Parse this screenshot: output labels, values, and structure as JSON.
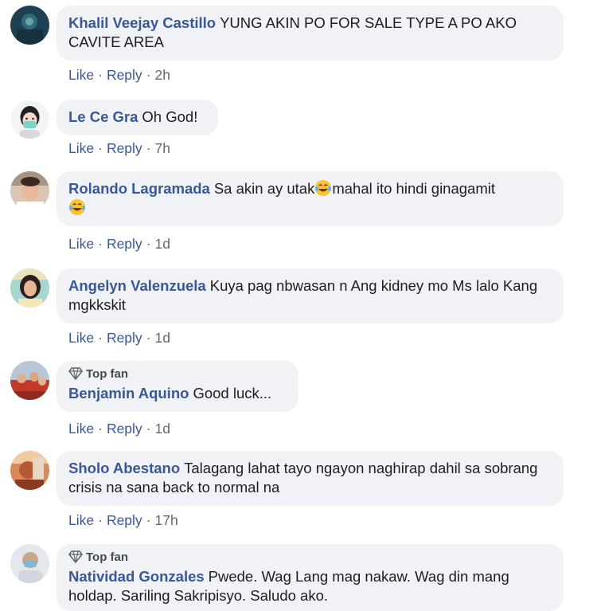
{
  "comments": [
    {
      "author": "Khalil Veejay Castillo",
      "text": "YUNG AKIN PO FOR SALE TYPE A PO AKO CAVITE AREA",
      "time": "2h",
      "top_fan": false,
      "avatar_icon": "profile-photo-dark-blue"
    },
    {
      "author": "Le Ce Gra",
      "text": "Oh God!",
      "time": "7h",
      "top_fan": false,
      "avatar_icon": "profile-cartoon-girl-mask"
    },
    {
      "author": "Rolando Lagramada",
      "text_before_emoji": "Sa akin ay utak",
      "text_after_emoji": "mahal ito hindi ginagamit",
      "emoji_icon": "laughing-tears-emoji",
      "time": "1d",
      "top_fan": false,
      "avatar_icon": "profile-photo-man"
    },
    {
      "author": "Angelyn Valenzuela",
      "text": "Kuya pag nbwasan n Ang kidney mo Ms lalo Kang mgkkskit",
      "time": "1d",
      "top_fan": false,
      "avatar_icon": "profile-photo-woman"
    },
    {
      "author": "Benjamin Aquino",
      "text": "Good luck...",
      "time": "1d",
      "top_fan": true,
      "avatar_icon": "profile-photo-group"
    },
    {
      "author": "Sholo Abestano",
      "text": "Talagang lahat tayo ngayon naghirap dahil sa sobrang crisis na sana back to normal na",
      "time": "17h",
      "top_fan": false,
      "avatar_icon": "profile-photo-warm"
    },
    {
      "author": "Natividad Gonzales",
      "text": "Pwede. Wag Lang mag nakaw. Wag din mang holdap. Sariling Sakripisyo. Saludo ako.",
      "top_fan": true,
      "avatar_icon": "profile-photo-masked"
    }
  ],
  "labels": {
    "like": "Like",
    "reply": "Reply",
    "dot": "·",
    "top_fan": "Top fan"
  },
  "colors": {
    "author": "#385898",
    "bubble": "#f0f2f5",
    "meta": "#65676b"
  }
}
